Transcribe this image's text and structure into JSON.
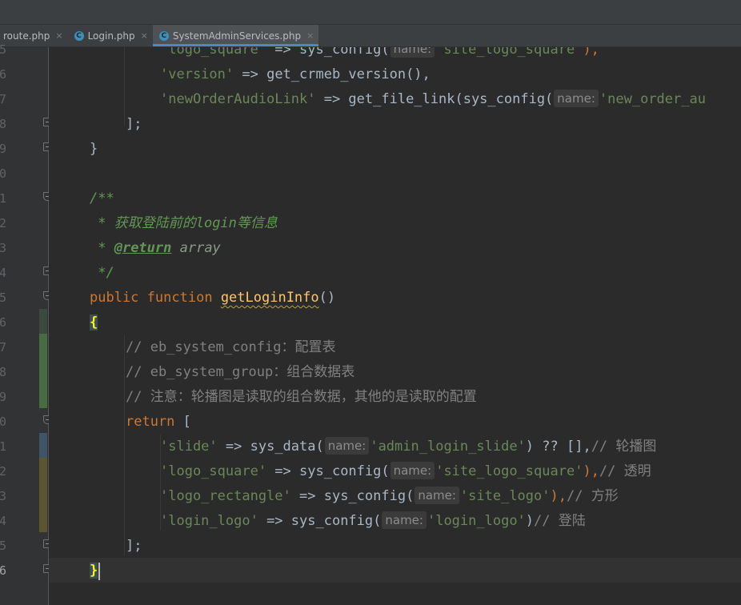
{
  "tabs": [
    {
      "label": "route.php",
      "icon": "",
      "active": false
    },
    {
      "label": "Login.php",
      "icon": "php-class-icon",
      "active": false
    },
    {
      "label": "SystemAdminServices.php",
      "icon": "php-class-icon",
      "active": true
    }
  ],
  "tab_close_glyph": "×",
  "line_numbers": [
    "5",
    "6",
    "7",
    "8",
    "9",
    "0",
    "1",
    "2",
    "3",
    "4",
    "5",
    "6",
    "7",
    "8",
    "9",
    "0",
    "1",
    "2",
    "3",
    "4",
    "5",
    "6"
  ],
  "param_hint_label": "name:",
  "code": {
    "l5": {
      "p1": "'logo_square'",
      "p2": " => ",
      "p3": "sys_config(",
      "p5": "'site_logo_square'",
      "p6": "),"
    },
    "l6": {
      "p1": "'version'",
      "p2": " => ",
      "p3": "get_crmeb_version(),",
      "p4": ""
    },
    "l7": {
      "p1": "'newOrderAudioLink'",
      "p2": " => ",
      "p3": "get_file_link(sys_config(",
      "p5": "'new_order_au"
    },
    "l8": {
      "p1": "];"
    },
    "l9": {
      "p1": "}"
    },
    "l11": {
      "p1": "/**"
    },
    "l12": {
      "p1": " * ",
      "p2": "获取登陆前的",
      "p3": "login",
      "p4": "等信息"
    },
    "l13": {
      "p1": " * ",
      "p2": "@return",
      "p3": " array"
    },
    "l14": {
      "p1": " */"
    },
    "l15": {
      "p1": "public",
      "p2": " ",
      "p3": "function",
      "p4": " ",
      "p5": "getLoginInfo",
      "p6": "()"
    },
    "l16": {
      "p1": "{"
    },
    "l17": {
      "p1": "// eb_system_config：",
      "p2": "配置表"
    },
    "l18": {
      "p1": "// eb_system_group：",
      "p2": "组合数据表"
    },
    "l19": {
      "p1": "// ",
      "p2": "注意：轮播图是读取的组合数据，其他的是读取的配置"
    },
    "l20": {
      "p1": "return",
      "p2": " ["
    },
    "l21": {
      "p1": "'slide'",
      "p2": " => ",
      "p3": "sys_data(",
      "p5": "'admin_login_slide'",
      "p6": ") ?? [],",
      "p7": "// ",
      "p8": "轮播图"
    },
    "l22": {
      "p1": "'logo_square'",
      "p2": " => ",
      "p3": "sys_config(",
      "p5": "'site_logo_square'",
      "p6": "),",
      "p7": "// ",
      "p8": "透明"
    },
    "l23": {
      "p1": "'logo_rectangle'",
      "p2": " => ",
      "p3": "sys_config(",
      "p5": "'site_logo'",
      "p6": "),",
      "p7": "// ",
      "p8": "方形"
    },
    "l24": {
      "p1": "'login_logo'",
      "p2": " => ",
      "p3": "sys_config(",
      "p5": "'login_logo'",
      "p6": ")",
      "p7": "// ",
      "p8": "登陆"
    },
    "l25": {
      "p1": "];"
    },
    "l26": {
      "p1": "}"
    }
  }
}
